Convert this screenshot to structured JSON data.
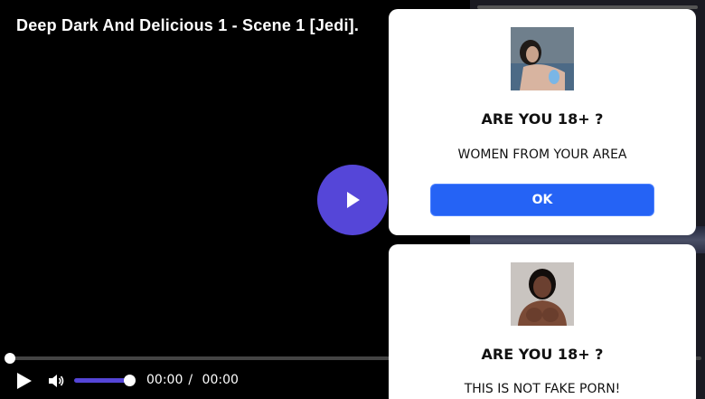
{
  "video": {
    "title": "Deep Dark And Delicious 1 - Scene 1 [Jedi].",
    "current_time": "00:00",
    "separator": "/",
    "duration": "00:00",
    "progress": 0,
    "volume": 1.0
  },
  "ads": [
    {
      "photo": "woman-photo",
      "heading": "ARE YOU 18+ ?",
      "text": "WOMEN FROM YOUR AREA",
      "button_label": "OK"
    },
    {
      "photo": "woman-photo",
      "heading": "ARE YOU 18+ ?",
      "text": "THIS IS NOT FAKE PORN!"
    }
  ],
  "colors": {
    "accent": "#5546d8",
    "button_blue": "#2563f5"
  }
}
